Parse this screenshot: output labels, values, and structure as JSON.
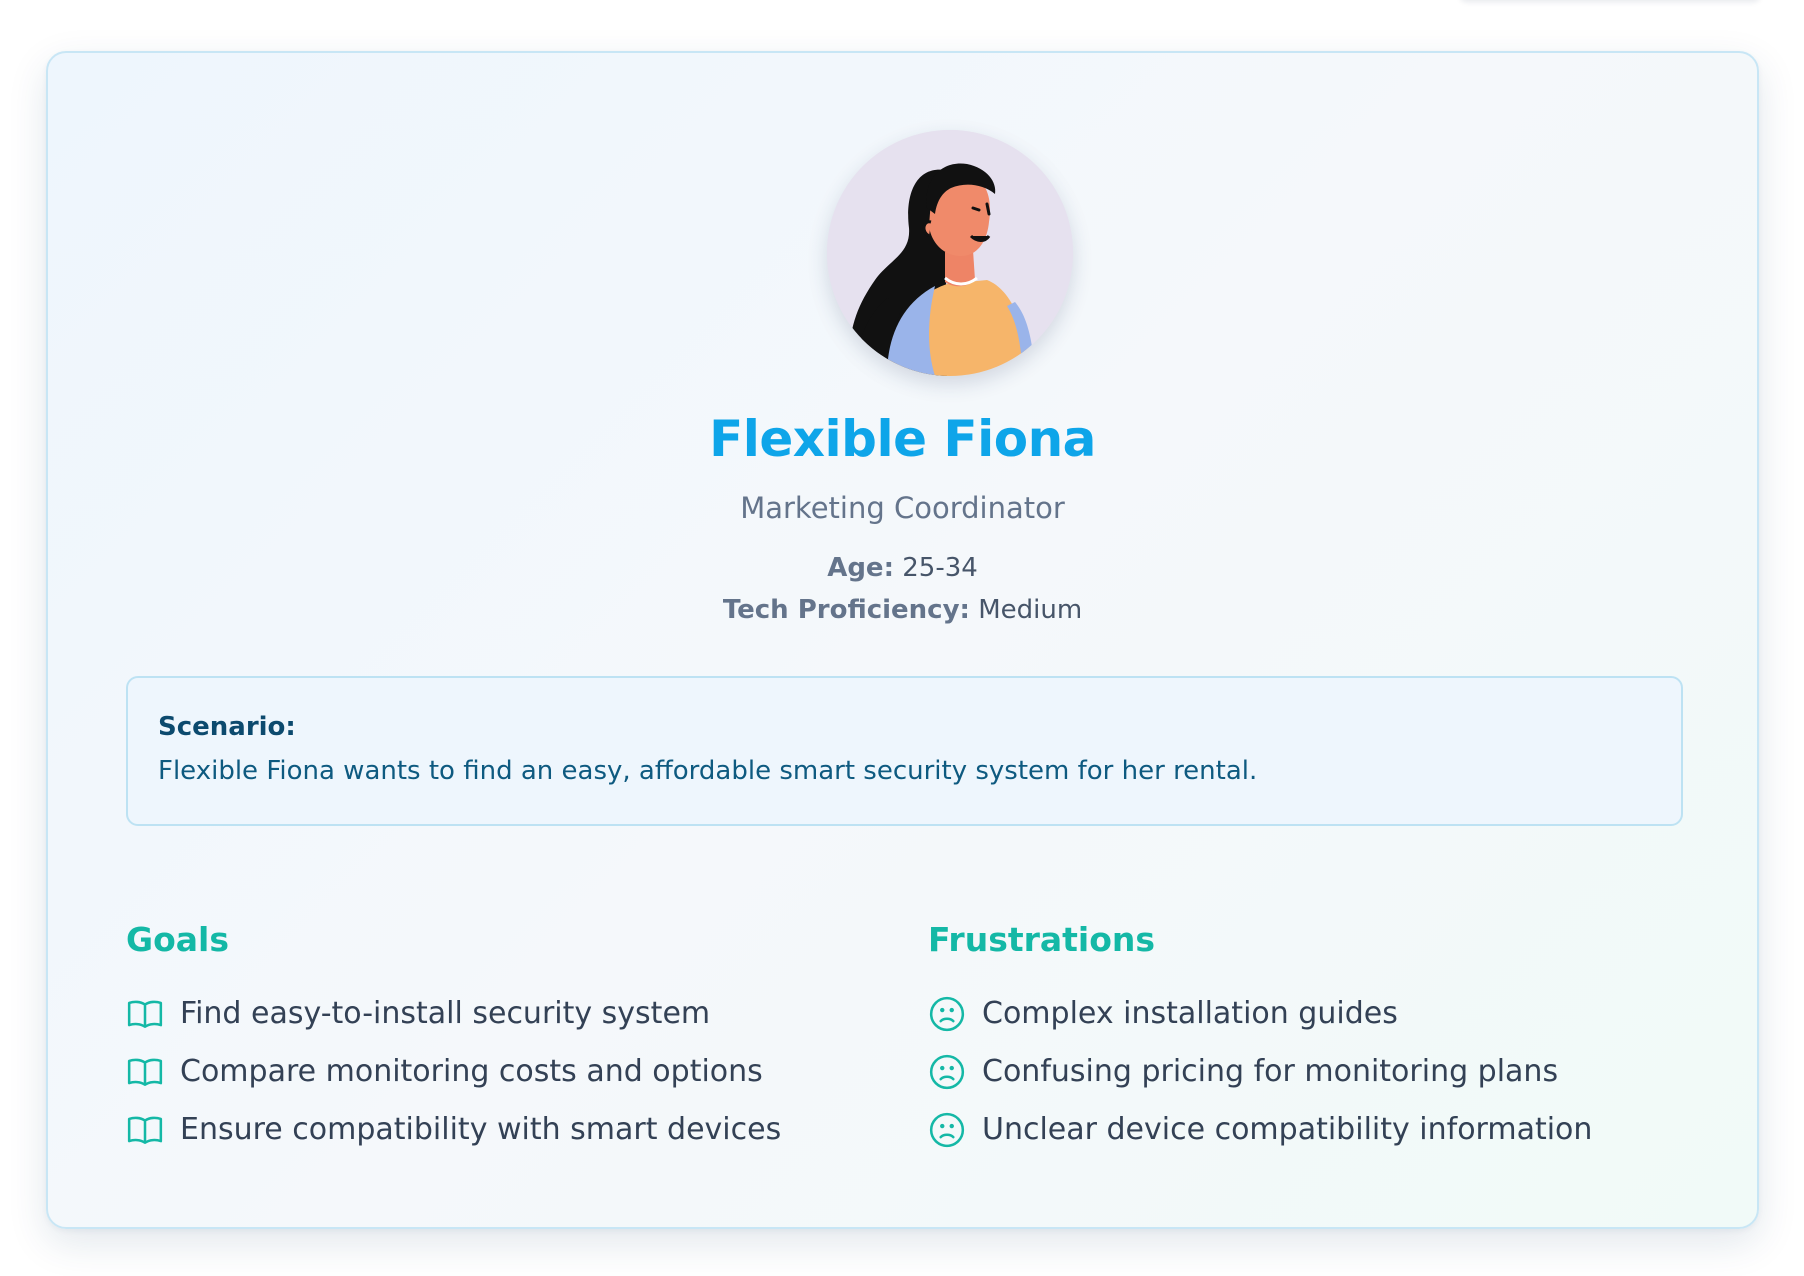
{
  "persona": {
    "name": "Flexible Fiona",
    "role": "Marketing Coordinator",
    "age_label": "Age:",
    "age_value": "25-34",
    "tech_label": "Tech Proficiency:",
    "tech_value": "Medium",
    "avatar_icon": "woman-avatar-illustration"
  },
  "scenario": {
    "title": "Scenario:",
    "text": "Flexible Fiona wants to find an easy, affordable smart security system for her rental."
  },
  "goals": {
    "title": "Goals",
    "icon": "book-open-icon",
    "items": [
      "Find easy-to-install security system",
      "Compare monitoring costs and options",
      "Ensure compatibility with smart devices"
    ]
  },
  "frustrations": {
    "title": "Frustrations",
    "icon": "frown-face-icon",
    "items": [
      "Complex installation guides",
      "Confusing pricing for monitoring plans",
      "Unclear device compatibility information"
    ]
  },
  "colors": {
    "accent_blue": "#0ea5e9",
    "accent_teal": "#14b8a6",
    "card_border": "#c8e6f5"
  }
}
